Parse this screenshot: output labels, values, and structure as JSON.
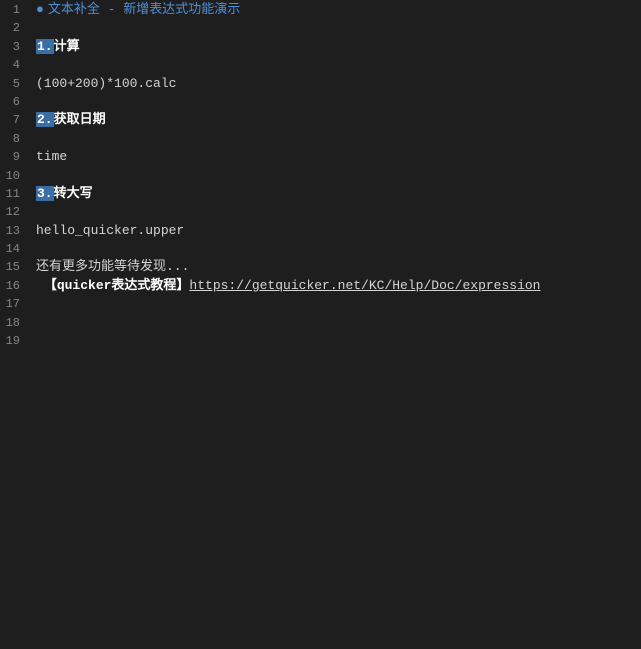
{
  "lineNumbers": [
    "1",
    "2",
    "3",
    "4",
    "5",
    "6",
    "7",
    "8",
    "9",
    "10",
    "11",
    "12",
    "13",
    "14",
    "15",
    "16",
    "17",
    "18",
    "19"
  ],
  "title": {
    "dot": "●",
    "text": "文本补全 - 新增表达式功能演示"
  },
  "sections": {
    "s1": {
      "num": "1.",
      "label": "计算",
      "body": "(100+200)*100.calc"
    },
    "s2": {
      "num": "2.",
      "label": "获取日期",
      "body": "time"
    },
    "s3": {
      "num": "3.",
      "label": "转大写",
      "body": "hello_quicker.upper"
    }
  },
  "footer": {
    "more": "还有更多功能等待发现...",
    "tutorialLabel": "【quicker表达式教程】",
    "url": "https://getquicker.net/KC/Help/Doc/expression"
  }
}
